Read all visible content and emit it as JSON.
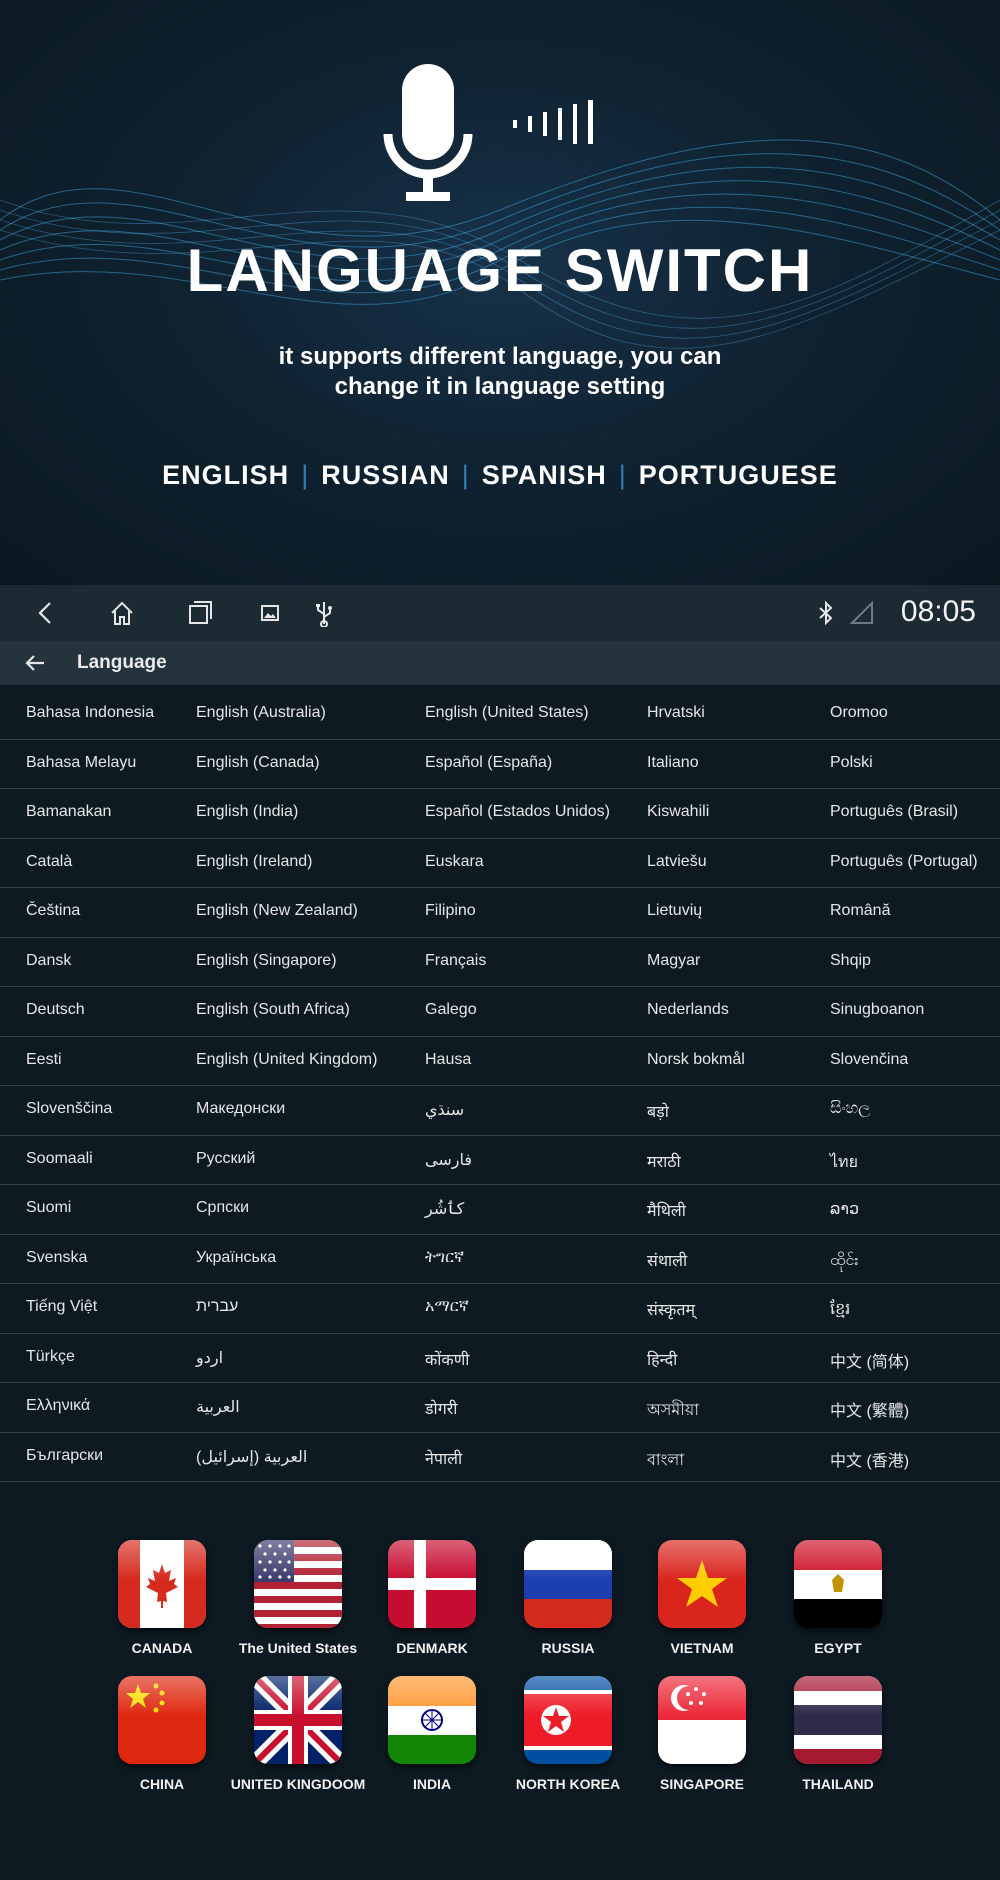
{
  "hero": {
    "title": "LANGUAGE SWITCH",
    "subtitle_line1": "it supports different language, you can",
    "subtitle_line2": "change it in language setting",
    "languages": [
      "ENGLISH",
      "RUSSIAN",
      "SPANISH",
      "PORTUGUESE"
    ]
  },
  "statusbar": {
    "time": "08:05",
    "icons": [
      "back-icon",
      "home-icon",
      "recents-icon",
      "gallery-icon",
      "usb-icon",
      "bluetooth-icon",
      "signal-icon"
    ]
  },
  "appbar": {
    "title": "Language"
  },
  "languages": [
    [
      "Bahasa Indonesia",
      "English (Australia)",
      "English (United States)",
      "Hrvatski",
      "Oromoo"
    ],
    [
      "Bahasa Melayu",
      "English (Canada)",
      "Español (España)",
      "Italiano",
      "Polski"
    ],
    [
      "Bamanakan",
      "English (India)",
      "Español (Estados Unidos)",
      "Kiswahili",
      "Português (Brasil)"
    ],
    [
      "Català",
      "English (Ireland)",
      "Euskara",
      "Latviešu",
      "Português (Portugal)"
    ],
    [
      "Čeština",
      "English (New Zealand)",
      "Filipino",
      "Lietuvių",
      "Română"
    ],
    [
      "Dansk",
      "English (Singapore)",
      "Français",
      "Magyar",
      "Shqip"
    ],
    [
      "Deutsch",
      "English (South Africa)",
      "Galego",
      "Nederlands",
      "Sinugboanon"
    ],
    [
      "Eesti",
      "English (United Kingdom)",
      "Hausa",
      "Norsk bokmål",
      "Slovenčina"
    ],
    [
      "Slovenščina",
      "Македонски",
      "سنڌي",
      "बड़ो",
      "සිංහල"
    ],
    [
      "Soomaali",
      "Русский",
      "فارسی",
      "मराठी",
      "ไทย"
    ],
    [
      "Suomi",
      "Српски",
      "کٲشُر",
      "मैथिली",
      "ລາວ"
    ],
    [
      "Svenska",
      "Українська",
      "ትግርኛ",
      "संथाली",
      "ထိုင်း"
    ],
    [
      "Tiếng Việt",
      "עברית",
      "አማርኛ",
      "संस्कृतम्",
      "ខ្មែរ"
    ],
    [
      "Türkçe",
      "اردو",
      "कोंकणी",
      "हिन्दी",
      "中文 (简体)"
    ],
    [
      "Ελληνικά",
      "العربية",
      "डोगरी",
      "অসমীয়া",
      "中文 (繁體)"
    ],
    [
      "Български",
      "العربية (إسرائيل)",
      "नेपाली",
      "বাংলা",
      "中文 (香港)"
    ]
  ],
  "flags": [
    {
      "label": "CANADA",
      "icon": "canada-flag-icon"
    },
    {
      "label": "The United States",
      "icon": "usa-flag-icon"
    },
    {
      "label": "DENMARK",
      "icon": "denmark-flag-icon"
    },
    {
      "label": "RUSSIA",
      "icon": "russia-flag-icon"
    },
    {
      "label": "VIETNAM",
      "icon": "vietnam-flag-icon"
    },
    {
      "label": "EGYPT",
      "icon": "egypt-flag-icon"
    },
    {
      "label": "CHINA",
      "icon": "china-flag-icon"
    },
    {
      "label": "UNITED KINGDOOM",
      "icon": "uk-flag-icon"
    },
    {
      "label": "INDIA",
      "icon": "india-flag-icon"
    },
    {
      "label": "NORTH KOREA",
      "icon": "north-korea-flag-icon"
    },
    {
      "label": "SINGAPORE",
      "icon": "singapore-flag-icon"
    },
    {
      "label": "THAILAND",
      "icon": "thailand-flag-icon"
    }
  ],
  "colors": {
    "background": "#0d1a22",
    "accent": "#2f7fb5",
    "statusbar": "#1c2a33",
    "appbar": "#25333d"
  }
}
